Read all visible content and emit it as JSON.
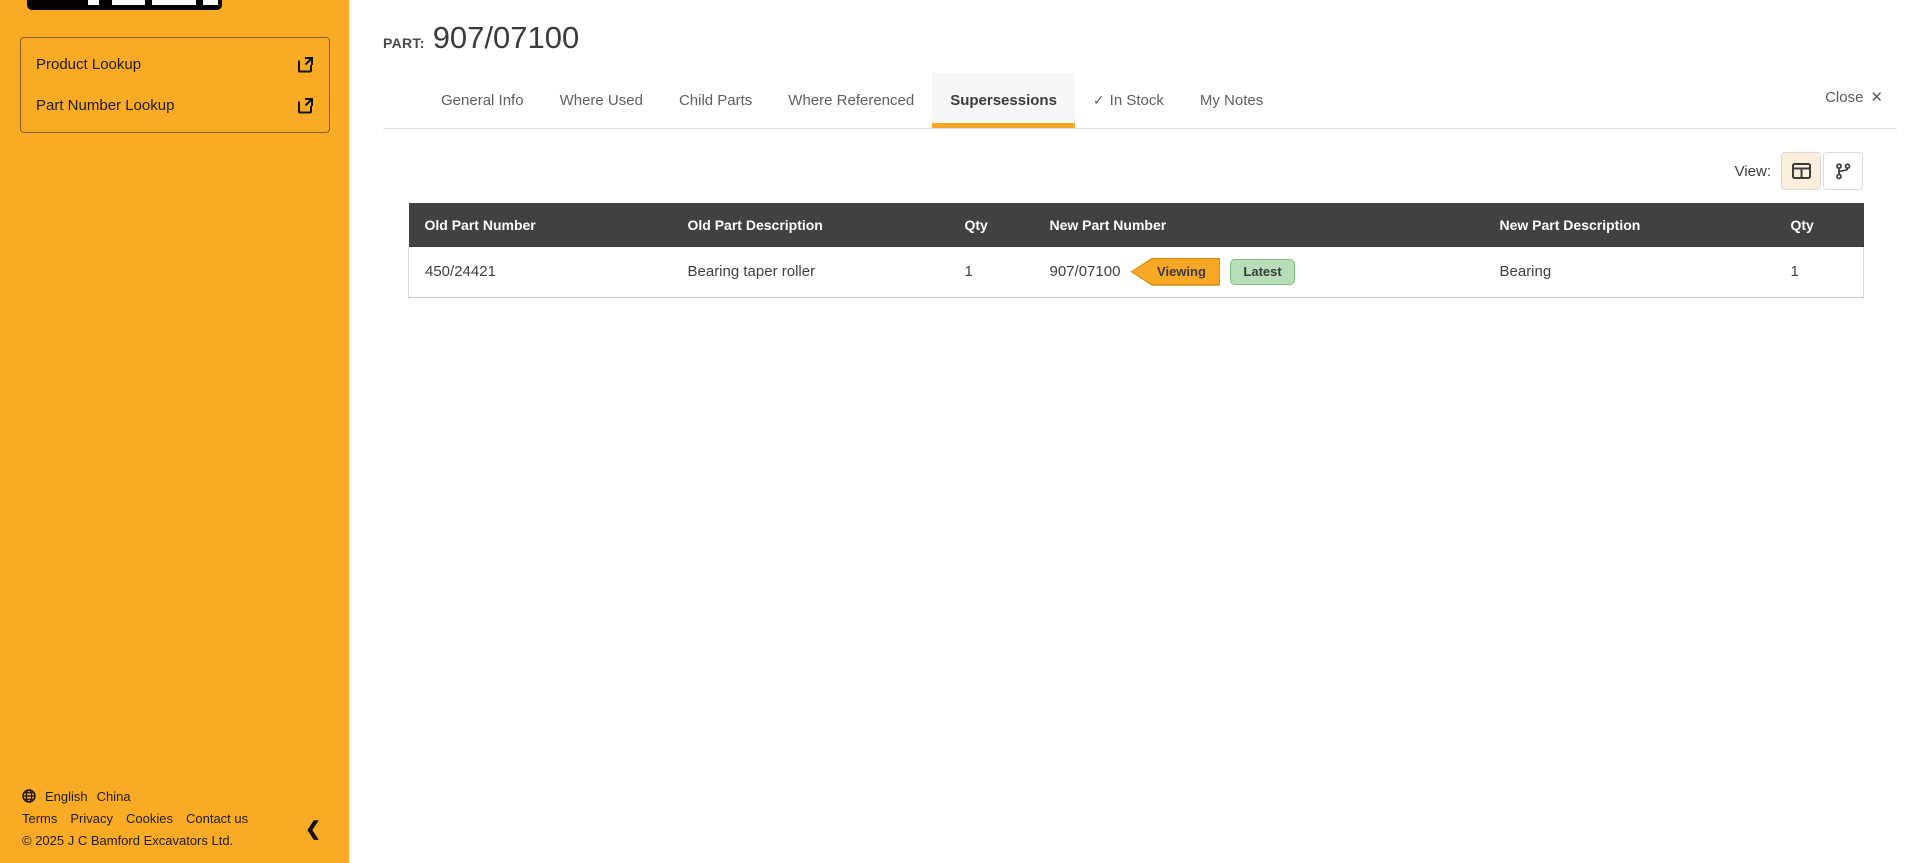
{
  "sidebar": {
    "nav_items": [
      {
        "label": "Product Lookup"
      },
      {
        "label": "Part Number Lookup"
      }
    ],
    "footer": {
      "language": "English",
      "country": "China",
      "links": [
        "Terms",
        "Privacy",
        "Cookies",
        "Contact us"
      ],
      "copyright": "© 2025 J C Bamford Excavators Ltd."
    },
    "collapse_icon": "❮"
  },
  "header": {
    "part_label": "PART:",
    "part_number": "907/07100",
    "close_label": "Close",
    "close_icon": "✕"
  },
  "tabs": [
    {
      "label": "General Info"
    },
    {
      "label": "Where Used"
    },
    {
      "label": "Child Parts"
    },
    {
      "label": "Where Referenced"
    },
    {
      "label": "Supersessions",
      "active": true
    },
    {
      "label": "In Stock",
      "check_icon": "✓"
    },
    {
      "label": "My Notes"
    }
  ],
  "view_toggle": {
    "label": "View:",
    "options": [
      {
        "name": "table-view",
        "active": true
      },
      {
        "name": "tree-view",
        "active": false
      }
    ]
  },
  "table": {
    "columns": [
      "Old Part Number",
      "Old Part Description",
      "Qty",
      "New Part Number",
      "New Part Description",
      "Qty"
    ],
    "rows": [
      {
        "old_part_number": "450/24421",
        "old_part_description": "Bearing taper roller",
        "old_qty": "1",
        "new_part_number": "907/07100",
        "viewing_badge": "Viewing",
        "latest_badge": "Latest",
        "new_part_description": "Bearing",
        "new_qty": "1"
      }
    ]
  },
  "colors": {
    "sidebar_orange": "#FAAB25",
    "accent_orange": "#F9A826",
    "table_header_bg": "#414141",
    "viewing_badge_fill": "#F9A826",
    "viewing_badge_border": "#D98E0B",
    "latest_badge_fill": "#B7DEB9",
    "latest_badge_border": "#77BF7B",
    "active_view_bg": "#FBEFDC"
  }
}
